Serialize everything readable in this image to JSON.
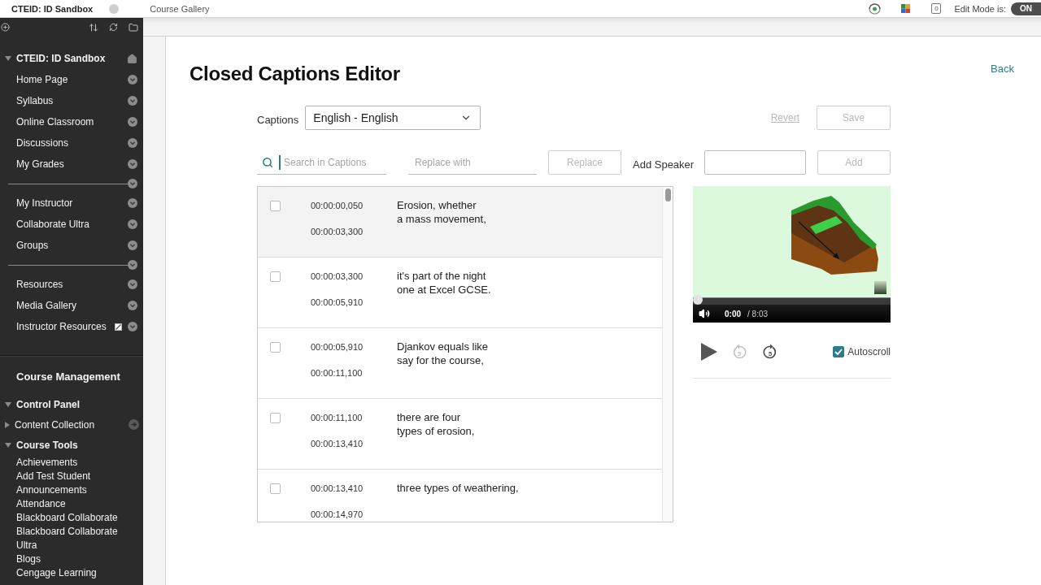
{
  "header": {
    "course": "CTEID: ID Sandbox",
    "breadcrumb": "Course Gallery",
    "notification_count": "0",
    "edit_mode_label": "Edit Mode is:",
    "edit_mode": {
      "label": "ON",
      "on": true
    }
  },
  "sidebar": {
    "course": {
      "label": "CTEID: ID Sandbox",
      "expanded": true
    },
    "menu": [
      {
        "kind": "link",
        "label": "Home Page",
        "hidden": false
      },
      {
        "kind": "link",
        "label": "Syllabus",
        "hidden": false
      },
      {
        "kind": "link",
        "label": "Online Classroom",
        "hidden": false
      },
      {
        "kind": "link",
        "label": "Discussions",
        "hidden": false
      },
      {
        "kind": "link",
        "label": "My Grades",
        "hidden": false
      },
      {
        "kind": "divider"
      },
      {
        "kind": "link",
        "label": "My Instructor",
        "hidden": false
      },
      {
        "kind": "link",
        "label": "Collaborate Ultra",
        "hidden": false
      },
      {
        "kind": "link",
        "label": "Groups",
        "hidden": false
      },
      {
        "kind": "divider"
      },
      {
        "kind": "link",
        "label": "Resources",
        "hidden": false
      },
      {
        "kind": "link",
        "label": "Media Gallery",
        "hidden": false
      },
      {
        "kind": "link",
        "label": "Instructor Resources",
        "hidden": true
      }
    ],
    "management": {
      "title": "Course Management",
      "tree": [
        {
          "label": "Control Panel",
          "expanded": true,
          "children": [
            {
              "label": "Content Collection",
              "expanded": false
            },
            {
              "label": "Course Tools",
              "expanded": true,
              "children": [
                {
                  "label": "Achievements"
                },
                {
                  "label": "Add Test Student"
                },
                {
                  "label": "Announcements"
                },
                {
                  "label": "Attendance"
                },
                {
                  "label": "Blackboard Collaborate"
                },
                {
                  "label": "Blackboard Collaborate Ultra"
                },
                {
                  "label": "Blogs"
                },
                {
                  "label": "Cengage Learning"
                }
              ]
            }
          ]
        }
      ]
    }
  },
  "editor": {
    "title": "Closed Captions Editor",
    "back": "Back",
    "captions_label": "Captions",
    "language": "English - English",
    "revert": {
      "label": "Revert",
      "disabled": true
    },
    "save": {
      "label": "Save",
      "disabled": true
    },
    "search": {
      "placeholder": "Search in Captions"
    },
    "replace_field": {
      "placeholder": "Replace with"
    },
    "replace": {
      "label": "Replace",
      "disabled": true
    },
    "speaker_label": "Add Speaker",
    "add": {
      "label": "Add",
      "disabled": true
    }
  },
  "captions": [
    {
      "start": "00:00:00,050",
      "end": "00:00:03,300",
      "text": "Erosion, whether\na mass movement,",
      "checked": false,
      "selected": true
    },
    {
      "start": "00:00:03,300",
      "end": "00:00:05,910",
      "text": "it's part of the night\none at Excel GCSE.",
      "checked": false,
      "selected": false
    },
    {
      "start": "00:00:05,910",
      "end": "00:00:11,100",
      "text": "Djankov equals like\nsay for the course,",
      "checked": false,
      "selected": false
    },
    {
      "start": "00:00:11,100",
      "end": "00:00:13,410",
      "text": "there are four\ntypes of erosion,",
      "checked": false,
      "selected": false
    },
    {
      "start": "00:00:13,410",
      "end": "00:00:14,970",
      "text": "three types of weathering,",
      "checked": false,
      "selected": false
    }
  ],
  "player": {
    "time": "0:00",
    "duration": "/ 8:03",
    "level": 0,
    "controls": [
      {
        "kind": "play",
        "disabled": false
      },
      {
        "kind": "rewind",
        "label": "5",
        "disabled": true
      },
      {
        "kind": "forward",
        "label": "5",
        "disabled": false
      }
    ],
    "autoscroll": {
      "label": "Autoscroll",
      "checked": true
    }
  }
}
